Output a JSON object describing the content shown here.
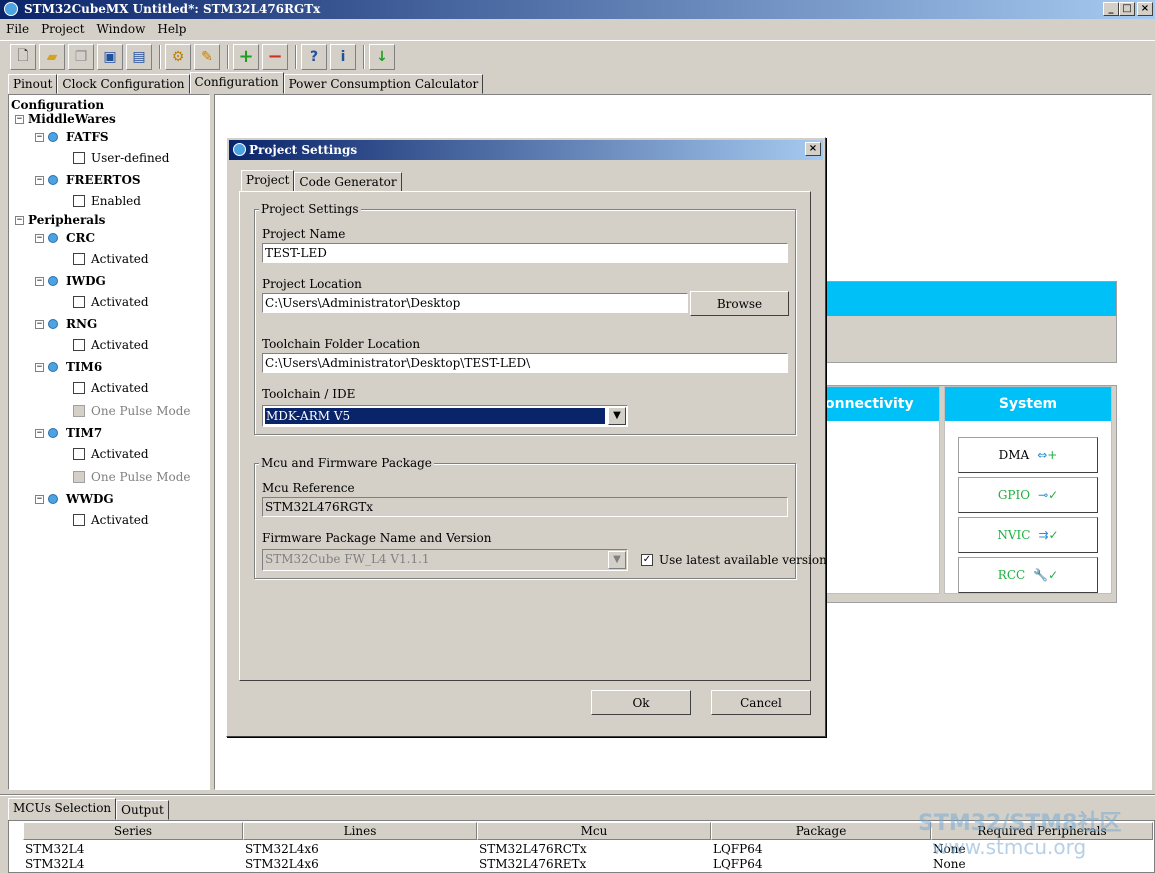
{
  "window": {
    "title": "STM32CubeMX Untitled*: STM32L476RGTx"
  },
  "menu": [
    "File",
    "Project",
    "Window",
    "Help"
  ],
  "main_tabs": [
    "Pinout",
    "Clock Configuration",
    "Configuration",
    "Power Consumption Calculator"
  ],
  "tree": {
    "root": "Configuration",
    "middlewares": "MiddleWares",
    "fatfs": "FATFS",
    "fatfs_opt": "User-defined",
    "freertos": "FREERTOS",
    "freertos_opt": "Enabled",
    "peripherals": "Peripherals",
    "crc": "CRC",
    "iwdg": "IWDG",
    "rng": "RNG",
    "tim6": "TIM6",
    "tim7": "TIM7",
    "wwdg": "WWDG",
    "activated": "Activated",
    "one_pulse": "One Pulse Mode"
  },
  "canvas": {
    "connectivity": "onnectivity",
    "system": "System",
    "dma": "DMA",
    "gpio": "GPIO",
    "nvic": "NVIC",
    "rcc": "RCC"
  },
  "dialog": {
    "title": "Project Settings",
    "tabs": [
      "Project",
      "Code Generator"
    ],
    "group1": "Project Settings",
    "project_name_label": "Project Name",
    "project_name": "TEST-LED",
    "project_location_label": "Project Location",
    "project_location": "C:\\Users\\Administrator\\Desktop",
    "browse": "Browse",
    "toolchain_folder_label": "Toolchain Folder Location",
    "toolchain_folder": "C:\\Users\\Administrator\\Desktop\\TEST-LED\\",
    "toolchain_ide_label": "Toolchain / IDE",
    "toolchain_ide": "MDK-ARM V5",
    "group2": "Mcu and Firmware Package",
    "mcu_ref_label": "Mcu Reference",
    "mcu_ref": "STM32L476RGTx",
    "fw_label": "Firmware Package Name and Version",
    "fw_value": "STM32Cube FW_L4 V1.1.1",
    "use_latest": "Use latest available version",
    "ok": "Ok",
    "cancel": "Cancel"
  },
  "bottom": {
    "tabs": [
      "MCUs Selection",
      "Output"
    ],
    "columns": [
      "Series",
      "Lines",
      "Mcu",
      "Package",
      "Required Peripherals"
    ],
    "rows": [
      [
        "STM32L4",
        "STM32L4x6",
        "STM32L476RCTx",
        "LQFP64",
        "None"
      ],
      [
        "STM32L4",
        "STM32L4x6",
        "STM32L476RETx",
        "LQFP64",
        "None"
      ]
    ]
  },
  "watermark": {
    "line1": "STM32/STM8社区",
    "line2": "www.stmcu.org"
  },
  "colors": {
    "accent": "#00c0f8",
    "title_bar": "#0a246a"
  }
}
